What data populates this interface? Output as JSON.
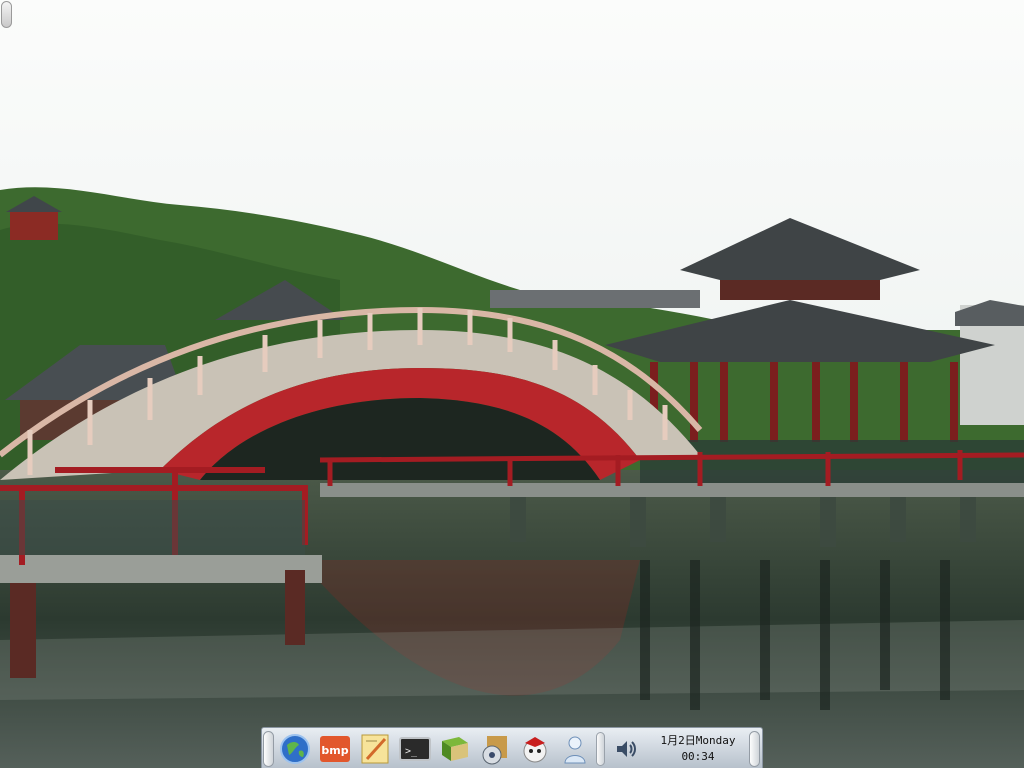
{
  "desktop": {
    "wallpaper": "wallpaper-pavilion-bridge",
    "colors": {
      "sky": "#f3f5f4",
      "water": "#2c3a30",
      "bridge_arch": "#b8262b",
      "railing": "#d9b7a6",
      "roof": "#3f4446",
      "hill": "#3d6a2f"
    }
  },
  "dock": {
    "launchers": [
      {
        "name": "browser-icon"
      },
      {
        "name": "image-viewer-icon",
        "label": "bmp"
      },
      {
        "name": "text-editor-icon"
      },
      {
        "name": "terminal-icon",
        "label": ">_"
      },
      {
        "name": "book-icon"
      },
      {
        "name": "disk-utility-icon"
      },
      {
        "name": "game-icon"
      },
      {
        "name": "user-icon"
      }
    ],
    "tray": {
      "volume_icon": "volume-icon",
      "clock_date": "1月2日Monday",
      "clock_time": "00:34"
    }
  }
}
